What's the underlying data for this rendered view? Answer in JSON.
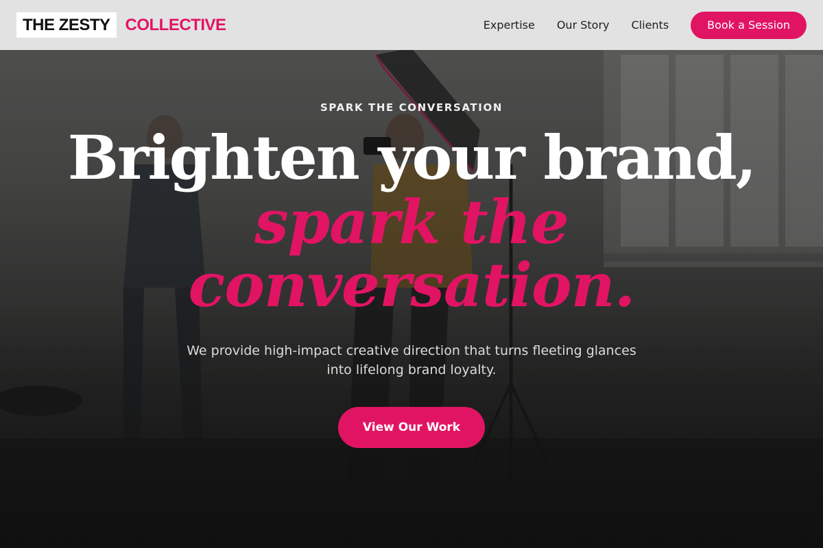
{
  "brand": {
    "name_part1": "THE ZESTY",
    "name_part2": "COLLECTIVE",
    "accent_color": "#e11463"
  },
  "nav": {
    "links": [
      {
        "label": "Expertise"
      },
      {
        "label": "Our Story"
      },
      {
        "label": "Clients"
      }
    ],
    "cta_label": "Book a Session"
  },
  "hero": {
    "eyebrow": "SPARK THE CONVERSATION",
    "headline_line1": "Brighten your brand,",
    "headline_accent_line1": "spark the",
    "headline_accent_line2": "conversation.",
    "subcopy": "We provide high-impact creative direction that turns fleeting glances into lifelong brand loyalty.",
    "cta_label": "View Our Work",
    "background_icon": "photo-studio-image"
  }
}
